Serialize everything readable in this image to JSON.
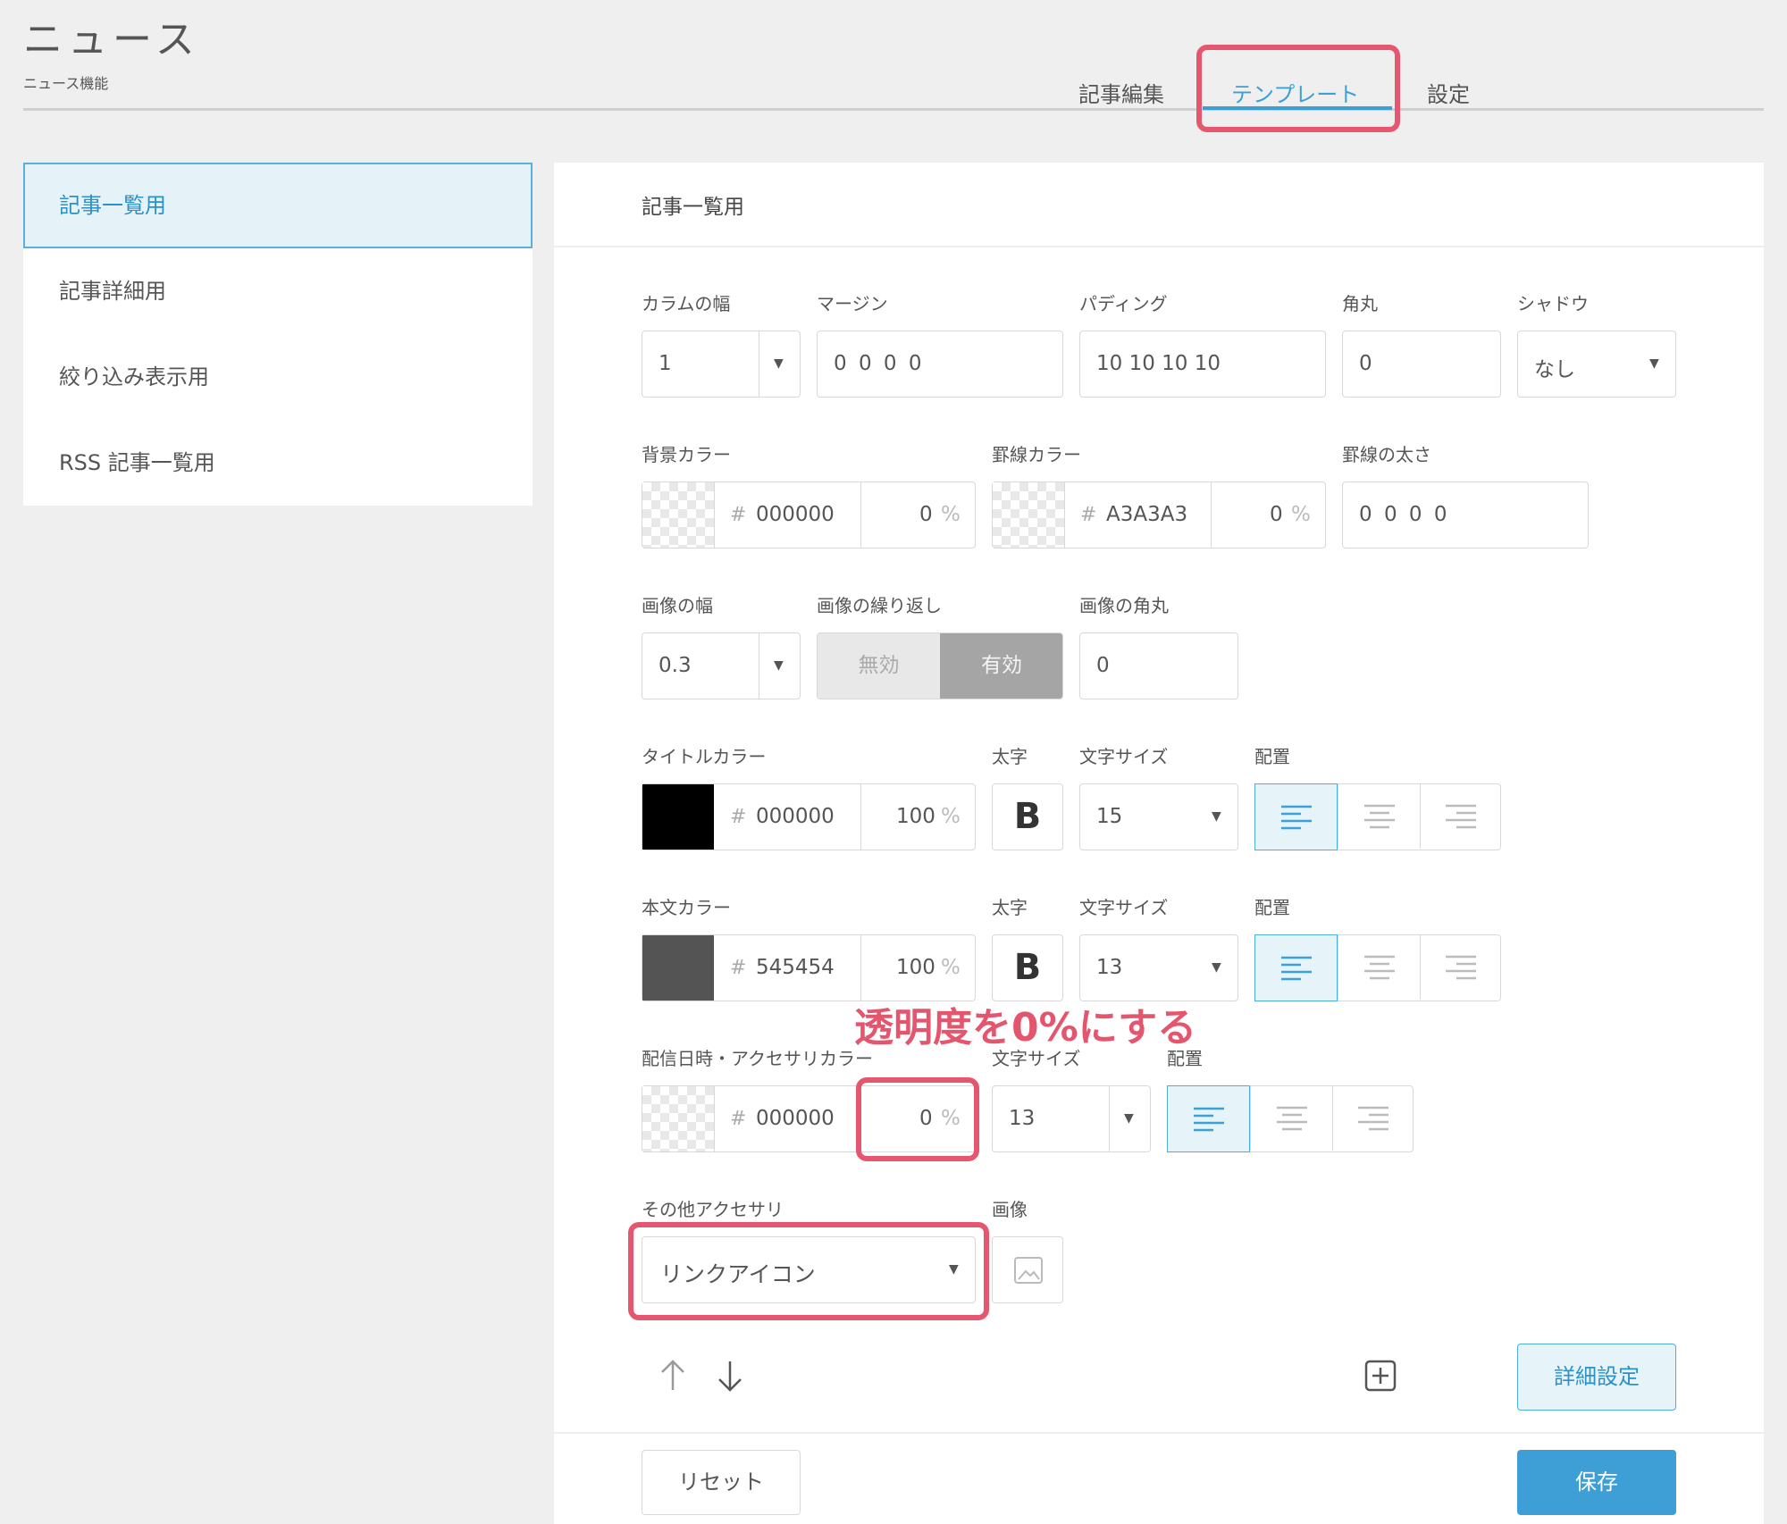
{
  "page": {
    "title": "ニュース",
    "subtitle": "ニュース機能"
  },
  "tabs": [
    {
      "label": "記事編集"
    },
    {
      "label": "テンプレート"
    },
    {
      "label": "設定"
    }
  ],
  "sidebar": {
    "items": [
      {
        "label": "記事一覧用"
      },
      {
        "label": "記事詳細用"
      },
      {
        "label": "絞り込み表示用"
      },
      {
        "label": "RSS 記事一覧用"
      }
    ]
  },
  "panel": {
    "title": "記事一覧用",
    "column_width": {
      "label": "カラムの幅",
      "value": "1"
    },
    "margin": {
      "label": "マージン",
      "value": "0 0 0 0"
    },
    "padding": {
      "label": "パディング",
      "value": "10 10 10 10"
    },
    "radius": {
      "label": "角丸",
      "value": "0"
    },
    "shadow": {
      "label": "シャドウ",
      "value": "なし"
    },
    "bg_color": {
      "label": "背景カラー",
      "hash": "#",
      "hex": "000000",
      "opacity": "0",
      "pct": "%"
    },
    "border_color": {
      "label": "罫線カラー",
      "hash": "#",
      "hex": "A3A3A3",
      "opacity": "0",
      "pct": "%"
    },
    "border_width": {
      "label": "罫線の太さ",
      "value": "0 0 0 0"
    },
    "image_width": {
      "label": "画像の幅",
      "value": "0.3"
    },
    "image_repeat": {
      "label": "画像の繰り返し",
      "off": "無効",
      "on": "有効"
    },
    "image_radius": {
      "label": "画像の角丸",
      "value": "0"
    },
    "title_color": {
      "label": "タイトルカラー",
      "hash": "#",
      "hex": "000000",
      "opacity": "100",
      "pct": "%",
      "swatch": "#000000"
    },
    "title_bold": {
      "label": "太字",
      "glyph": "B"
    },
    "title_size": {
      "label": "文字サイズ",
      "value": "15"
    },
    "title_align": {
      "label": "配置"
    },
    "body_color": {
      "label": "本文カラー",
      "hash": "#",
      "hex": "545454",
      "opacity": "100",
      "pct": "%",
      "swatch": "#545454"
    },
    "body_bold": {
      "label": "太字",
      "glyph": "B"
    },
    "body_size": {
      "label": "文字サイズ",
      "value": "13"
    },
    "body_align": {
      "label": "配置"
    },
    "accessory_color": {
      "label": "配信日時・アクセサリカラー",
      "hash": "#",
      "hex": "000000",
      "opacity": "0",
      "pct": "%"
    },
    "accessory_size": {
      "label": "文字サイズ",
      "value": "13"
    },
    "accessory_align": {
      "label": "配置"
    },
    "other_accessory": {
      "label": "その他アクセサリ",
      "value": "リンクアイコン"
    },
    "image": {
      "label": "画像"
    },
    "detail_button": "詳細設定",
    "reset_button": "リセット",
    "save_button": "保存"
  },
  "annotation": {
    "text": "透明度を0%にする"
  },
  "colors": {
    "accent": "#3aa0d6",
    "highlight": "#e5576f",
    "save": "#3d9fd5"
  }
}
